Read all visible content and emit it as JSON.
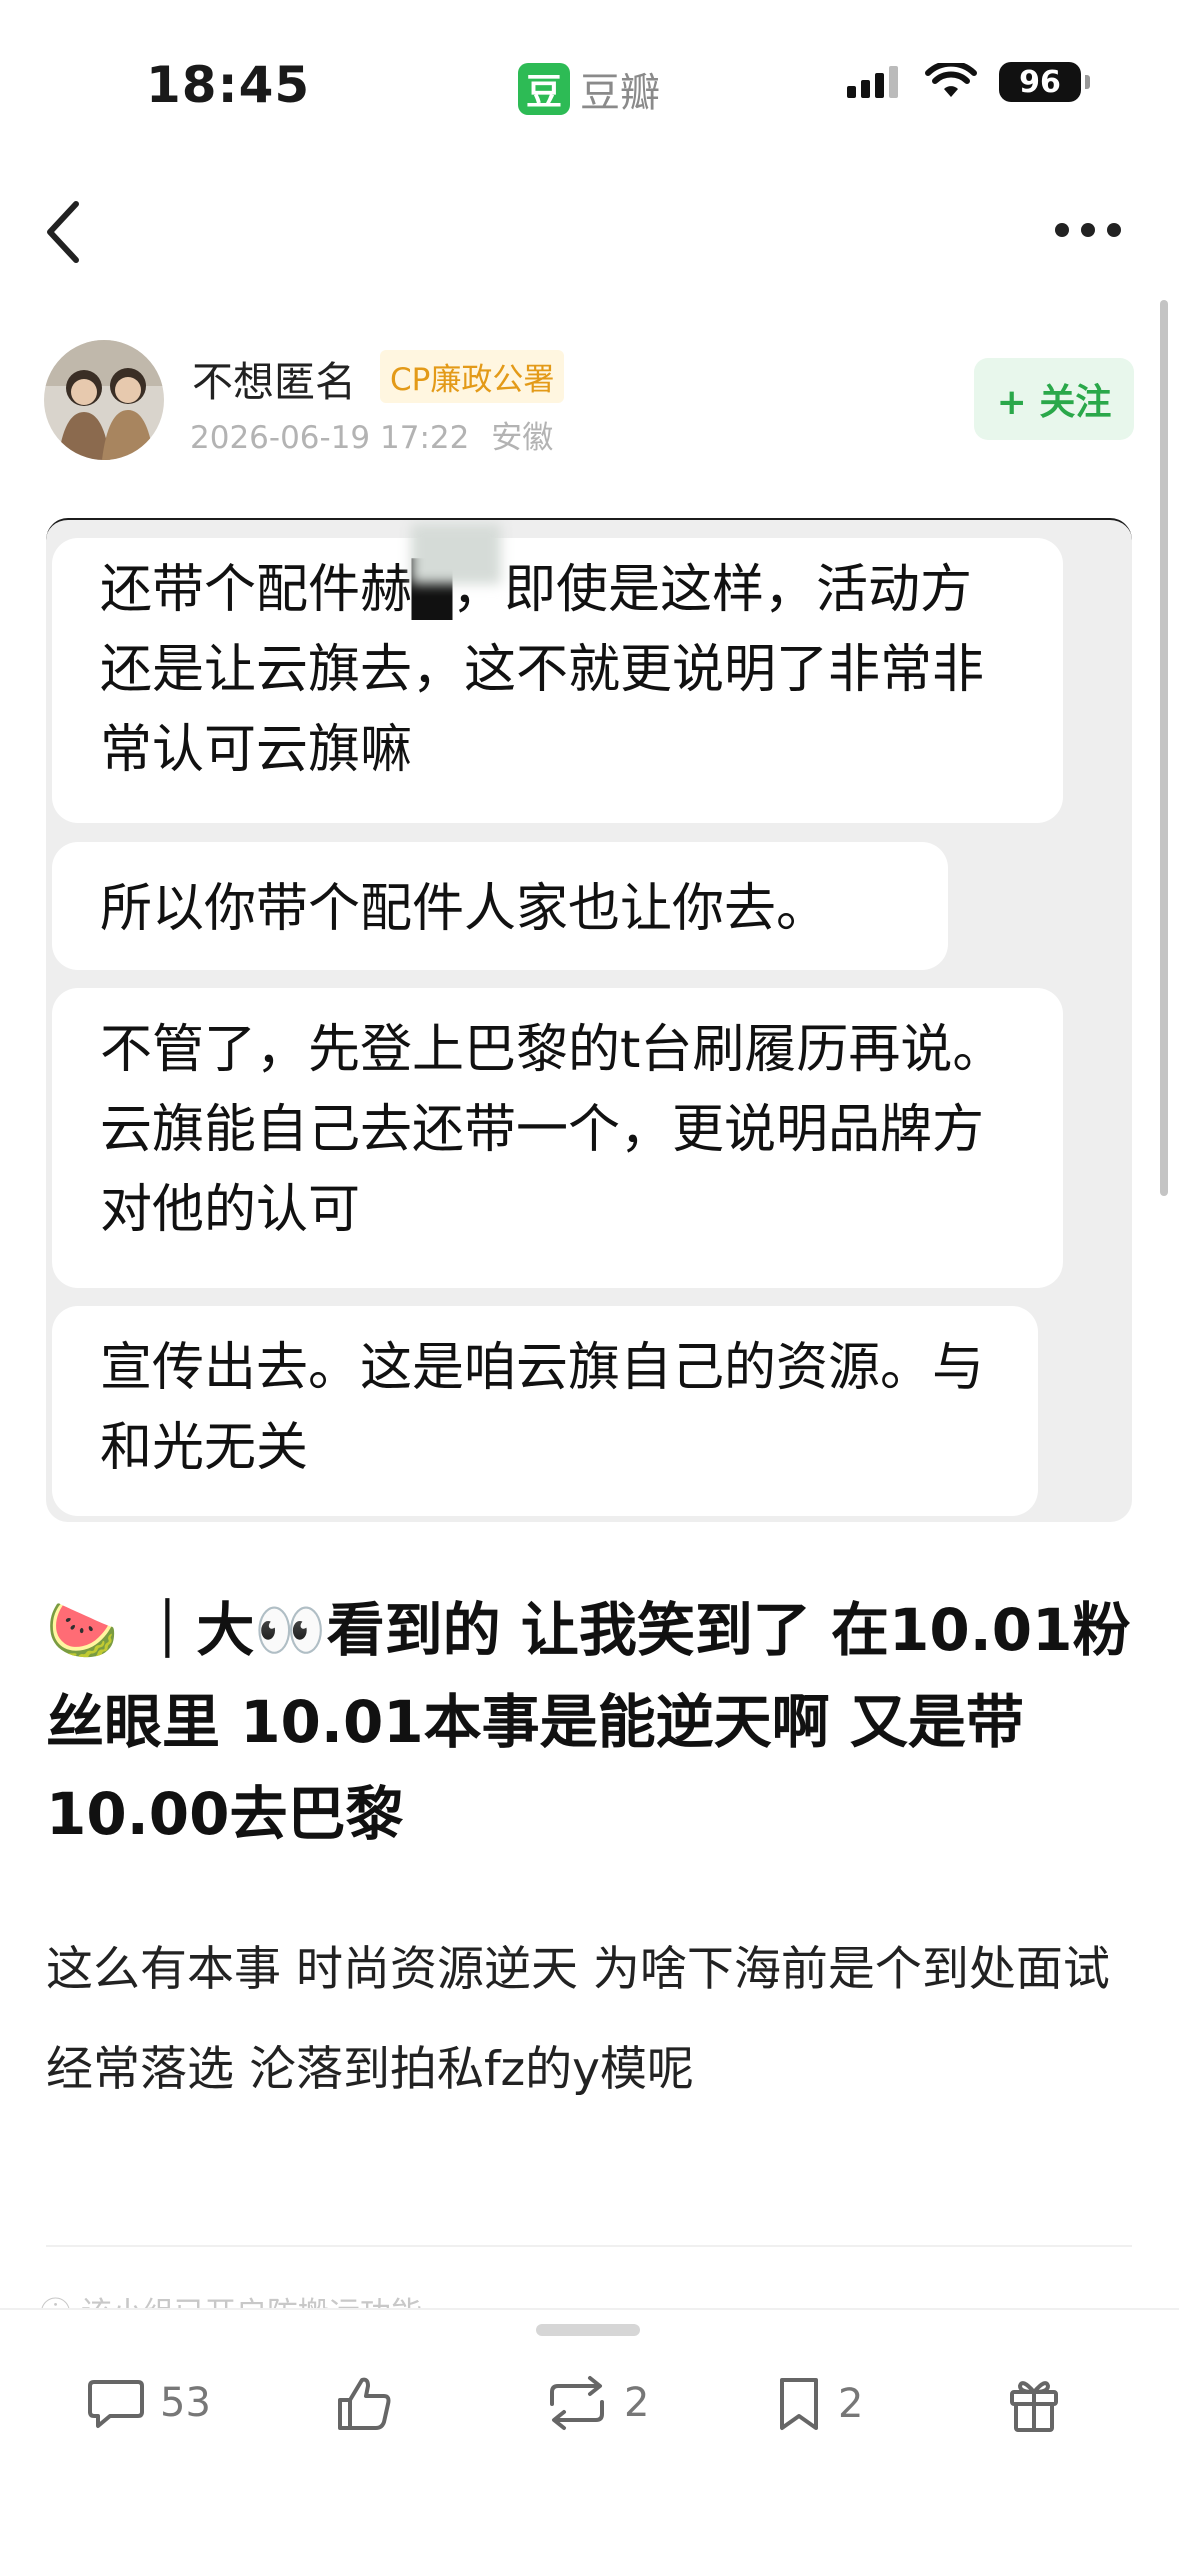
{
  "status_bar": {
    "time": "18:45",
    "app_logo_char": "豆",
    "app_name": "豆瓣",
    "battery": "96"
  },
  "author": {
    "name": "不想匿名",
    "badge": "CP廉政公署",
    "timestamp": "2026-06-19 17:22",
    "location": "安徽",
    "follow_label": "+ 关注"
  },
  "screenshot_bubbles": [
    {
      "text": "还带个配件赫█，即使是这样，活动方还是让云旗去，这不就更说明了非常非常认可云旗嘛"
    },
    {
      "text": "所以你带个配件人家也让你去。"
    },
    {
      "text": "不管了，先登上巴黎的t台刷履历再说。云旗能自己去还带一个，更说明品牌方对他的认可"
    },
    {
      "text": "宣传出去。这是咱云旗自己的资源。与和光无关"
    }
  ],
  "post": {
    "title_prefix": "🍉 ｜大👀看到的 让我笑到了 在10.01粉丝眼里 10.01本事是能逆天啊 又是带10.00去巴黎",
    "body": "这么有本事 时尚资源逆天 为啥下海前是个到处面试 经常落选  沦落到拍私fz的y模呢",
    "faded_note": "该小组已开启防搬运功能"
  },
  "toolbar": {
    "comments": "53",
    "reposts": "2",
    "collects": "2"
  },
  "colors": {
    "accent": "#2aa84a",
    "badge": "#e39a18"
  }
}
